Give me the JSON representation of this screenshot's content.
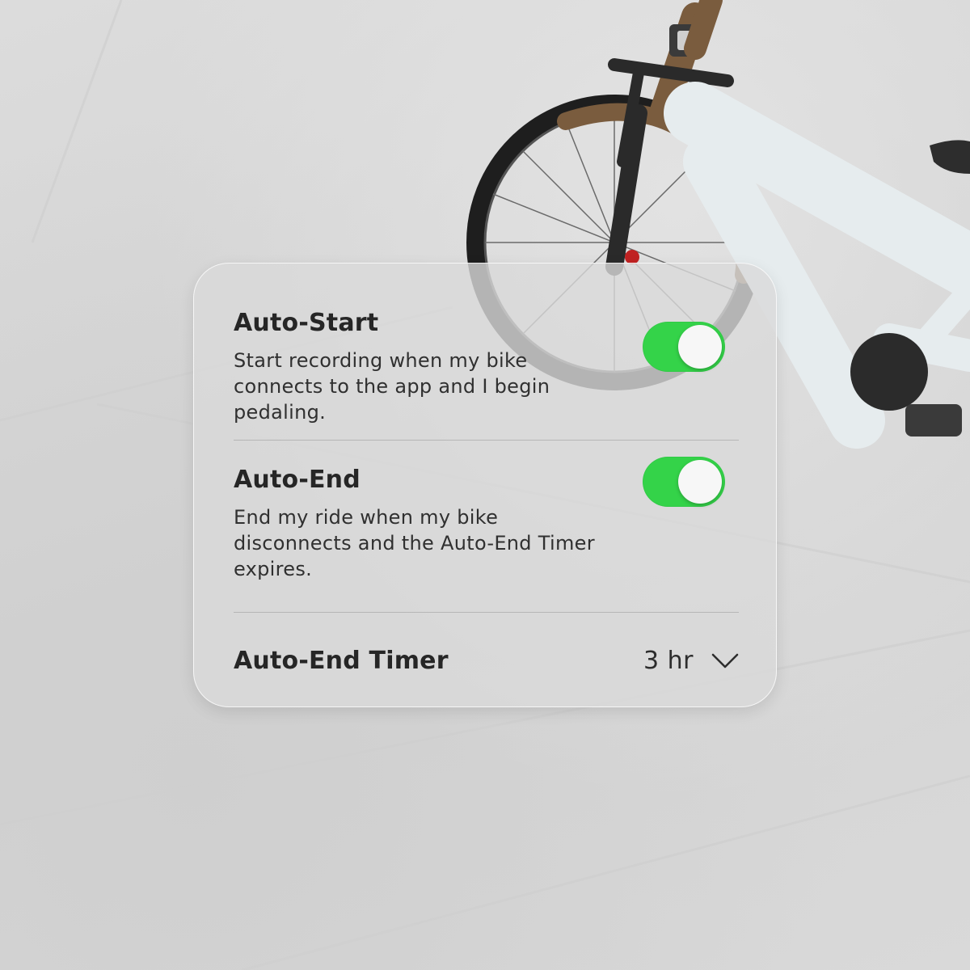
{
  "settings": {
    "auto_start": {
      "title": "Auto-Start",
      "description": "Start recording when my bike connects to the app and I begin pedaling.",
      "enabled": true
    },
    "auto_end": {
      "title": "Auto-End",
      "description": "End my ride when my bike disconnects and the Auto-End Timer expires.",
      "enabled": true
    },
    "auto_end_timer": {
      "title": "Auto-End Timer",
      "value": "3 hr"
    }
  },
  "colors": {
    "toggle_on": "#34d349",
    "knob": "#f7f7f7",
    "card": "#dadada",
    "text": "#262626"
  },
  "icons": {
    "dropdown": "chevron-down-icon"
  }
}
